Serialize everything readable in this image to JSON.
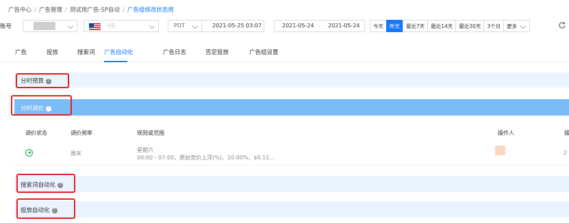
{
  "breadcrumb": {
    "items": [
      "广告中心",
      "广告管理",
      "测试用广告-SP自动",
      "广告组修改状态用"
    ],
    "separator": "/"
  },
  "toolbar": {
    "account_label": "账号",
    "marketplace": "US",
    "timezone": "PDT",
    "timestamp": "2021-05-25 03:07",
    "range_start": "2021-05-24",
    "range_sep": "-",
    "range_end": "2021-05-24",
    "quick_ranges": [
      "今天",
      "昨天",
      "最近7天",
      "最近14天",
      "最近30天",
      "3个月"
    ],
    "active_range": "昨天",
    "more_label": "更多"
  },
  "tabs": [
    "广告",
    "投放",
    "搜索词",
    "广告自动化",
    "广告日志",
    "否定投放",
    "广告组设置"
  ],
  "active_tab": "广告自动化",
  "sections": {
    "time_budget": "分时预算",
    "time_bid": "分时调价",
    "search_term_auto": "搜索词自动化",
    "targeting_auto": "投放自动化"
  },
  "table": {
    "headers": [
      "调价状态",
      "调价频率",
      "规则或范围",
      "操作人",
      "操"
    ],
    "rows": [
      {
        "status_icon": "play-circle-icon",
        "frequency": "周末",
        "rule_line1": "星期六",
        "rule_line2": "00:00 - 07:00，原始竞价上浮(%)，10.00%，$0.11...",
        "operator": "",
        "extra": "2"
      }
    ]
  },
  "colors": {
    "accent": "#1677ff",
    "highlight_section": "#7cbcf6",
    "light_section": "#eaf3ff",
    "annotation_box": "#e0201f",
    "status_green": "#1aa34a"
  }
}
